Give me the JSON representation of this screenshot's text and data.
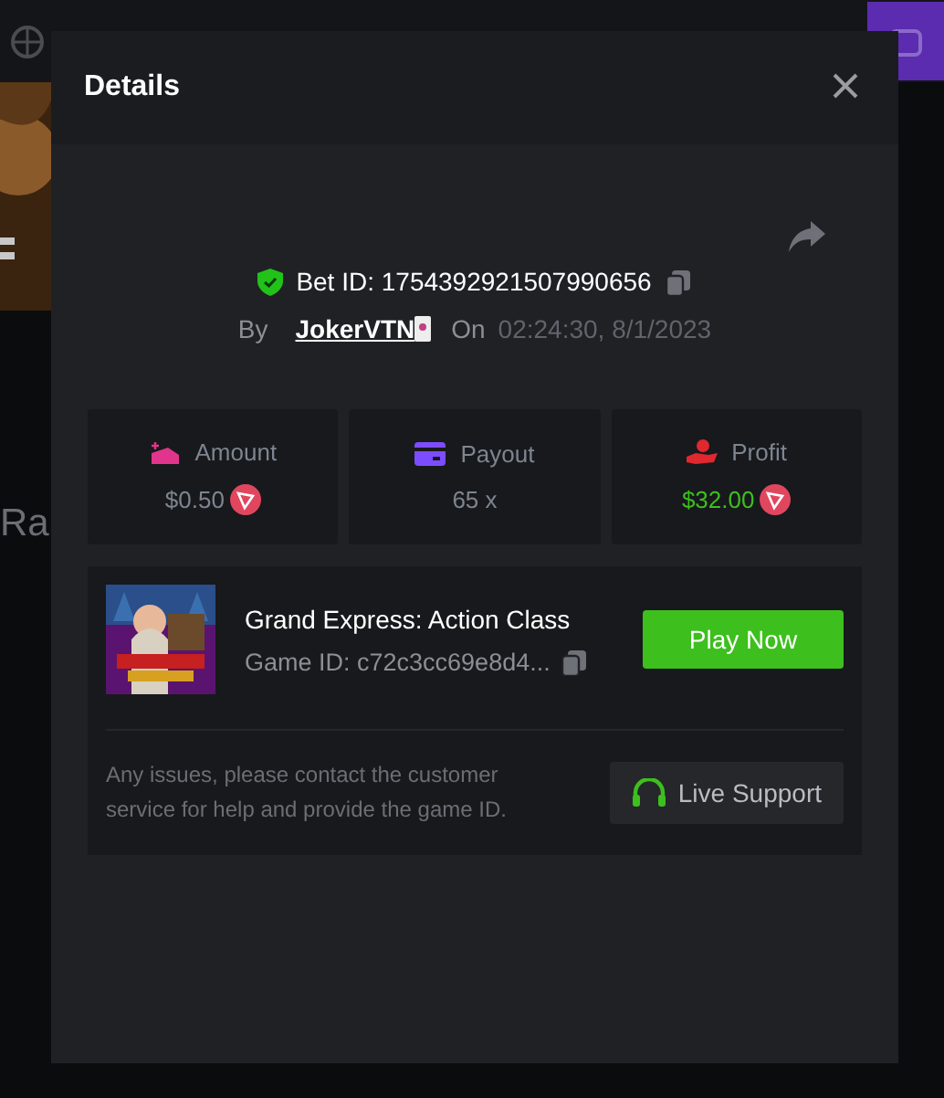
{
  "background": {
    "heading": "Ra"
  },
  "dialog": {
    "title": "Details",
    "bet_id": "Bet ID: 1754392921507990656",
    "by_label": "By",
    "user": "JokerVTN",
    "on_label": "On",
    "time": "02:24:30, 8/1/2023",
    "stats": [
      {
        "kind": "amount",
        "label": "Amount",
        "value": "$0.50",
        "color": "#7d8590",
        "currency_icon": true
      },
      {
        "kind": "payout",
        "label": "Payout",
        "value": "65 x",
        "color": "#7d8590",
        "currency_icon": false
      },
      {
        "kind": "profit",
        "label": "Profit",
        "value": "$32.00",
        "color": "#3dbf1e",
        "currency_icon": true
      }
    ],
    "game": {
      "title": "Grand Express: Action Class",
      "game_id": "Game ID: c72c3cc69e8d4...",
      "play_button": "Play Now"
    },
    "notice": "Any issues, please contact the customer service for help and provide the game ID.",
    "support_button": "Live Support"
  }
}
